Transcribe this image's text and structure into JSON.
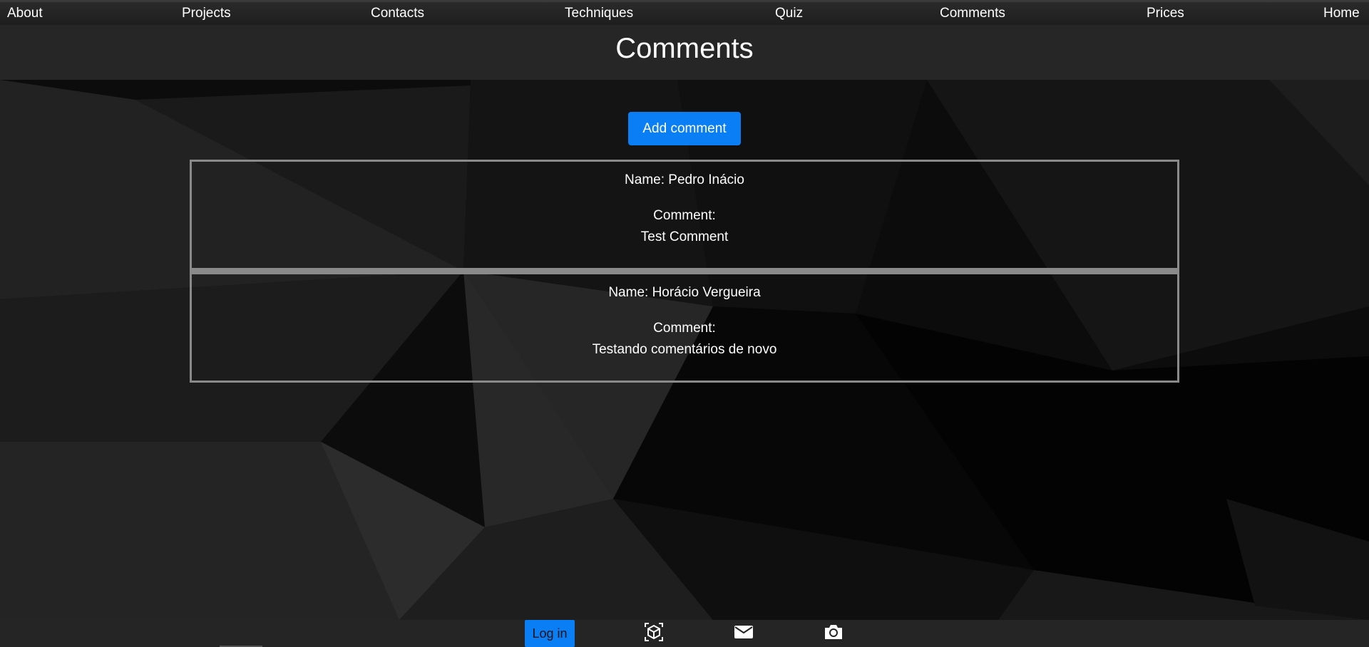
{
  "nav": {
    "items": [
      {
        "label": "About"
      },
      {
        "label": "Projects"
      },
      {
        "label": "Contacts"
      },
      {
        "label": "Techniques"
      },
      {
        "label": "Quiz"
      },
      {
        "label": "Comments"
      },
      {
        "label": "Prices"
      },
      {
        "label": "Home"
      }
    ]
  },
  "header": {
    "title": "Comments"
  },
  "main": {
    "add_comment_label": "Add comment",
    "comments": [
      {
        "name": "Name: Pedro Inácio",
        "label": "Comment:",
        "text": "Test Comment"
      },
      {
        "name": "Name: Horácio Vergueira",
        "label": "Comment:",
        "text": "Testando comentários de novo"
      }
    ]
  },
  "footer": {
    "login_label": "Log in",
    "icons": [
      "3d-cube-icon",
      "mail-icon",
      "camera-icon"
    ]
  },
  "colors": {
    "accent": "#0a7ef5",
    "card_border": "#8a8a8a",
    "nav_bg": "#262626"
  }
}
